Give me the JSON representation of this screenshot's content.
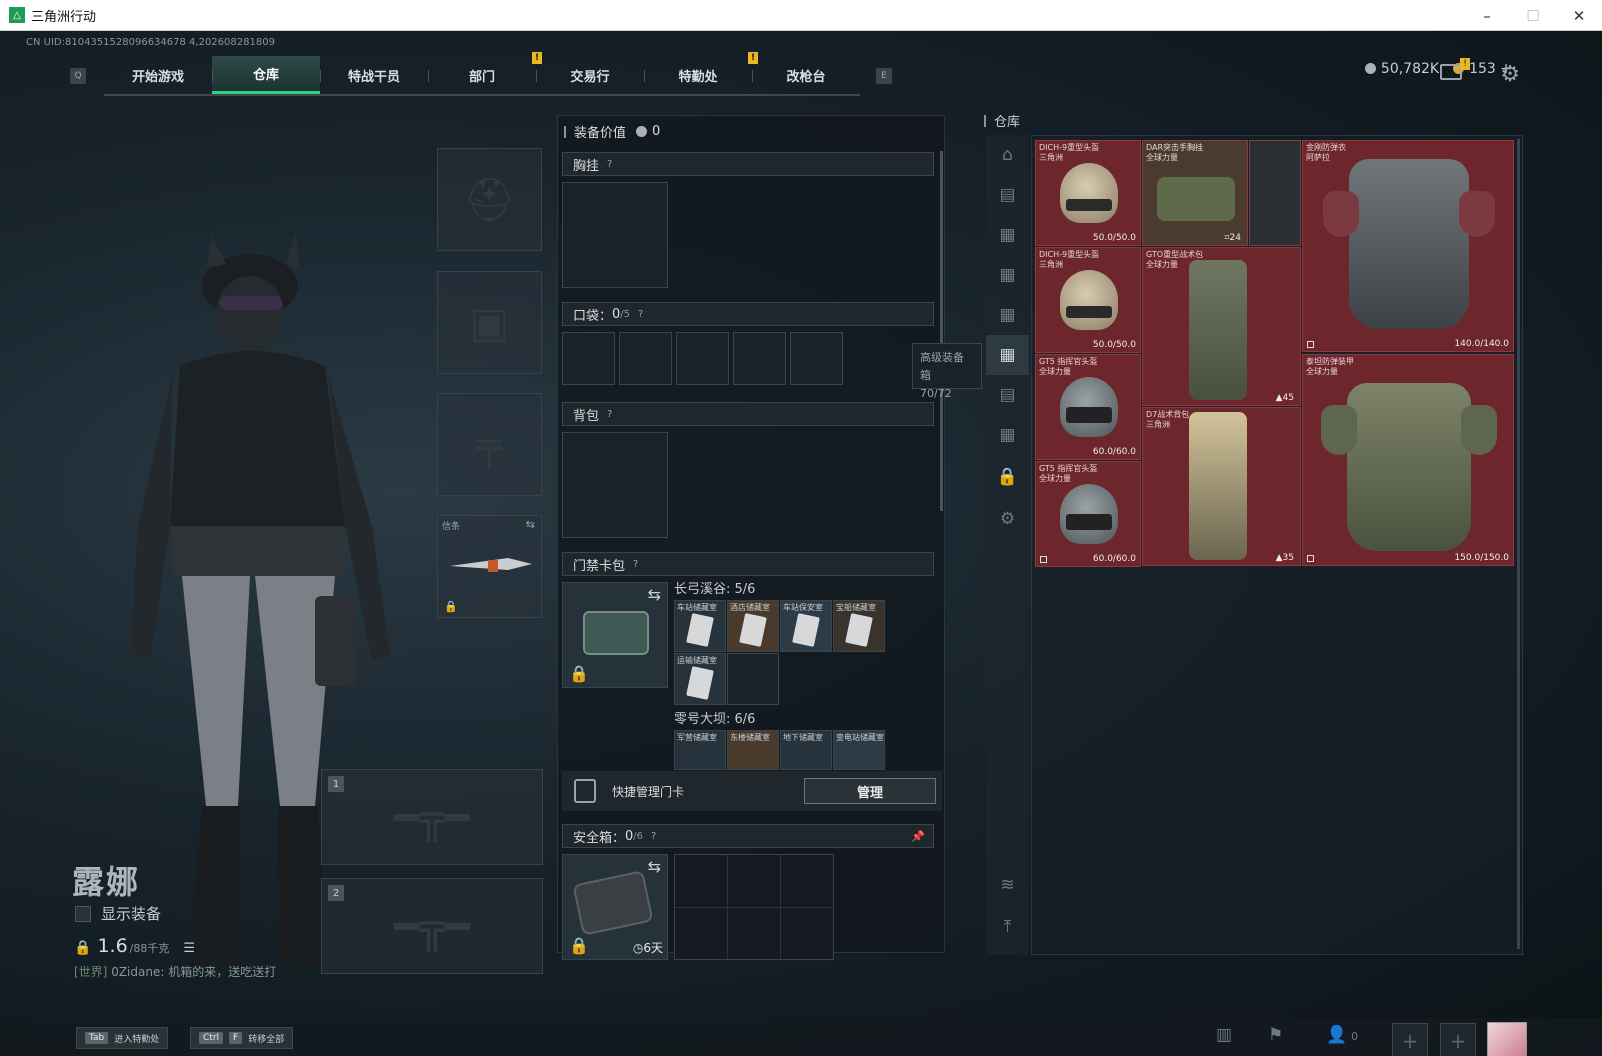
{
  "window": {
    "title": "三角洲行动",
    "minimize": "–",
    "maximize": "☐",
    "close": "✕"
  },
  "uid": "CN UID:8104351528096634678 4,202608281809",
  "nav": {
    "key_left": "Q",
    "key_right": "E",
    "tabs": [
      {
        "label": "开始游戏"
      },
      {
        "label": "仓库"
      },
      {
        "label": "特战干员"
      },
      {
        "label": "部门"
      },
      {
        "label": "交易行"
      },
      {
        "label": "特勤处"
      },
      {
        "label": "改枪台"
      }
    ],
    "badge": "!"
  },
  "currency": {
    "silver": "50,782K",
    "gold": "153",
    "plus": "+"
  },
  "character": {
    "name": "露娜",
    "show_equipment": "显示装备",
    "weight": "1.6",
    "weight_max": "/88千克"
  },
  "chat": {
    "channel": "[世界]",
    "text": "0Zidane: 机箱的来，送吃送打"
  },
  "loadout": {
    "melee_label": "信条",
    "slot1": "1",
    "slot2": "2"
  },
  "middle": {
    "equip_value_label": "装备价值",
    "equip_value": "0",
    "chest_label": "胸挂",
    "pocket_label": "口袋：",
    "pocket_count": "0",
    "pocket_max": "/5",
    "backpack_label": "背包",
    "keycard_label": "门禁卡包",
    "map1_label": "长弓溪谷: 5/6",
    "map2_label": "零号大坝: 6/6",
    "map1_cards": [
      "车站储藏室",
      "酒店储藏室",
      "车站保安室",
      "宝船储藏室",
      "运输储藏室"
    ],
    "map2_cards": [
      "军营储藏室",
      "东楼储藏室",
      "地下储藏室",
      "变电站储藏室"
    ],
    "quick_manage": "快捷管理门卡",
    "manage_btn": "管理",
    "safebox_label": "安全箱：",
    "safebox_count": "0",
    "safebox_max": "/6",
    "safebox_days": "6天",
    "q": "?"
  },
  "tooltip": {
    "title": "高级装备箱",
    "value": "70/72"
  },
  "warehouse": {
    "title": "仓库",
    "items": [
      {
        "name": "DICH-9重型头盔",
        "sub": "三角洲",
        "dur": "50.0/50.0"
      },
      {
        "name": "DAR突击手胸挂",
        "sub": "全球力量",
        "dur": "24"
      },
      {
        "name": "金刚防弹衣",
        "sub": "阿萨拉",
        "dur": ""
      },
      {
        "name": "DICH-9重型头盔",
        "sub": "三角洲",
        "dur": "50.0/50.0"
      },
      {
        "name": "GTO重型战术包",
        "sub": "全球力量",
        "dur": "45"
      },
      {
        "name": "",
        "sub": "",
        "dur": "140.0/140.0"
      },
      {
        "name": "GT5 指挥官头盔",
        "sub": "全球力量",
        "dur": "60.0/60.0"
      },
      {
        "name": "D7战术背包",
        "sub": "三角洲",
        "dur": "35"
      },
      {
        "name": "泰坦防弹装甲",
        "sub": "全球力量",
        "dur": "150.0/150.0"
      },
      {
        "name": "GT5 指挥官头盔",
        "sub": "全球力量",
        "dur": "60.0/60.0"
      }
    ]
  },
  "bottom": {
    "hint1_key": "Tab",
    "hint1_label": "进入特勤处",
    "hint2_key1": "Ctrl",
    "hint2_key2": "F",
    "hint2_label": "转移全部",
    "friends": "0"
  },
  "colors": {
    "accent": "#2ed28a",
    "item_bg": "#6d262c",
    "badge": "#e8b820"
  }
}
